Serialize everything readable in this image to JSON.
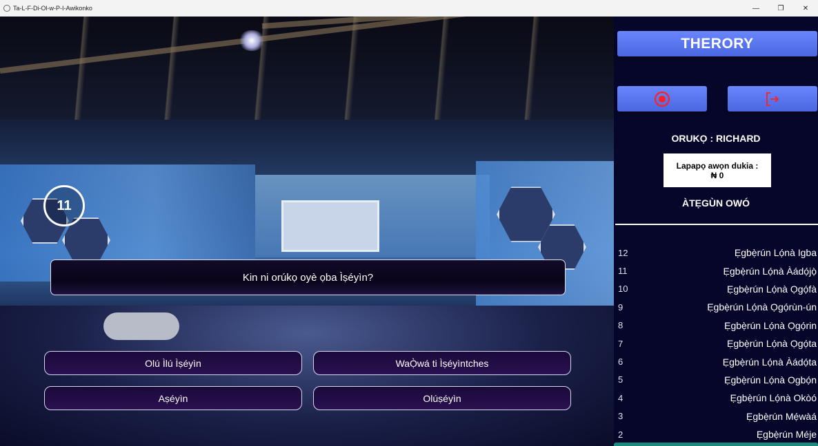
{
  "window": {
    "title": "Ta-L-F-Di-Ol-w-P-I-Awikonko",
    "controls": [
      "—",
      "❐",
      "✕"
    ]
  },
  "game": {
    "timer": "11",
    "question": "Kin ni orúkọ oyè ọba Ìṣéyìn?",
    "answers": [
      "Olú Ìlú Ìṣéyìn",
      "WaỌ̀wá ti Ìṣéyìntches",
      "Aṣéyìn",
      "Olúṣéyìn"
    ]
  },
  "panel": {
    "brand": "THERORY",
    "player_label": "ORUKỌ : RICHARD",
    "balance_label": "Lapapọ awọn dukia :",
    "balance_value": "₦ 0",
    "lifelines_label": "ÀTẸGÙN OWÓ",
    "stop_icon": "stop-circle-icon",
    "exit_icon": "exit-icon",
    "accent_color": "#5a76f0",
    "icon_color": "#ff2020"
  },
  "prize_ladder": [
    {
      "num": "12",
      "label": "Ẹgbẹ̀rún Lọ́nà Igba"
    },
    {
      "num": "11",
      "label": "Ẹgbẹ̀rún Lọ́nà Àádọ́jọ̀"
    },
    {
      "num": "10",
      "label": "Ẹgbẹ̀rún Lọ́nà Ọgọ́fà"
    },
    {
      "num": "9",
      "label": "Ẹgbẹ̀rún Lọ́nà Ọgọ́rùn-ún"
    },
    {
      "num": "8",
      "label": "Ẹgbẹ̀rún Lọ́nà Ọgọ́rin"
    },
    {
      "num": "7",
      "label": "Ẹgbẹ̀rún Lọ́nà Ọgọ́ta"
    },
    {
      "num": "6",
      "label": "Ẹgbẹ̀rún Lọ́nà Àádọ́ta"
    },
    {
      "num": "5",
      "label": "Ẹgbẹ̀rún Lọ́nà Ogbọ́n"
    },
    {
      "num": "4",
      "label": "Ẹgbẹ̀rún Lọ́nà Okòó"
    },
    {
      "num": "3",
      "label": "Ẹgbẹ̀rún Mẹ́wàá"
    },
    {
      "num": "2",
      "label": "Ẹgbẹ̀rún Méje"
    }
  ]
}
